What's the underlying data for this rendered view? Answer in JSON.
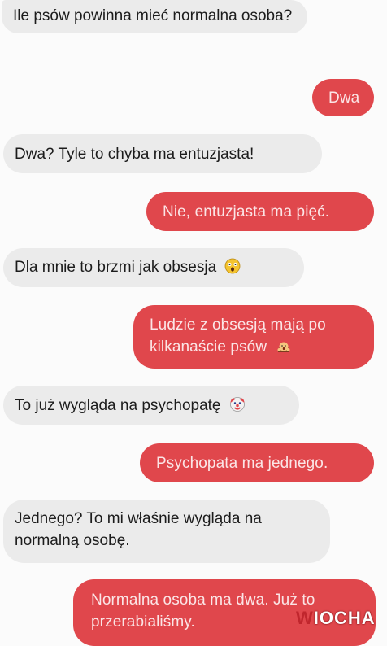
{
  "conversation": {
    "messages": [
      {
        "sender": "them",
        "text": "Ile psów powinna mieć normalna osoba?"
      },
      {
        "sender": "me",
        "text": "Dwa"
      },
      {
        "sender": "them",
        "text": "Dwa? Tyle to chyba ma entuzjasta!"
      },
      {
        "sender": "me",
        "text": "Nie, entuzjasta ma pięć."
      },
      {
        "sender": "them",
        "text": "Dla mnie to brzmi jak obsesja",
        "emoji": "astonished-face"
      },
      {
        "sender": "me",
        "text": "Ludzie z obsesją mają po kilkanaście psów",
        "emoji": "woman-with-hands-on-cheeks"
      },
      {
        "sender": "them",
        "text": "To już wygląda na psychopatę",
        "emoji": "clown-face"
      },
      {
        "sender": "me",
        "text": "Psychopata ma jednego."
      },
      {
        "sender": "them",
        "text": "Jednego? To mi właśnie wygląda na normalną osobę."
      },
      {
        "sender": "me",
        "text": "Normalna osoba ma dwa. Już to przerabialiśmy."
      }
    ]
  },
  "watermark": {
    "first_letter": "W",
    "rest": "IOCHA"
  },
  "colors": {
    "incoming_bubble": "#ebebeb",
    "outgoing_bubble": "#e0474c",
    "outgoing_text": "#fbe5e6",
    "background": "#fbfbfb"
  }
}
